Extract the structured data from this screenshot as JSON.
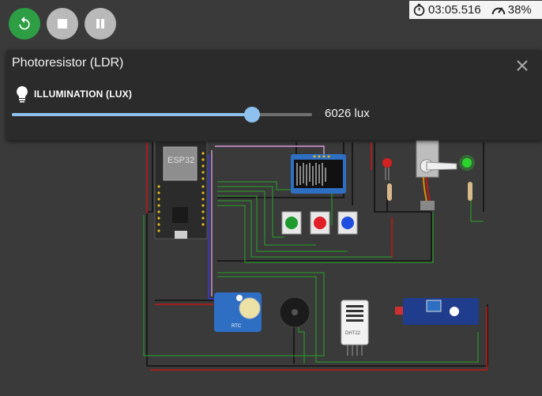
{
  "toolbar": {
    "restart_icon": "restart-icon",
    "stop_icon": "stop-icon",
    "pause_icon": "pause-icon"
  },
  "status": {
    "timer": "03:05.516",
    "cpu": "38%"
  },
  "panel": {
    "title": "Photoresistor (LDR)",
    "property_label": "ILLUMINATION (LUX)",
    "value_text": "6026 lux",
    "slider_level": 0.8
  },
  "board": {
    "esp32_label": "ESP32",
    "dht_label": "DHT22",
    "rtc_label": "RTC"
  },
  "colors": {
    "restart": "#2e9e45",
    "slider": "#8ec1ee",
    "button_green": "#1e9a2e",
    "button_red": "#e01f26",
    "button_blue": "#1e4ee0"
  }
}
